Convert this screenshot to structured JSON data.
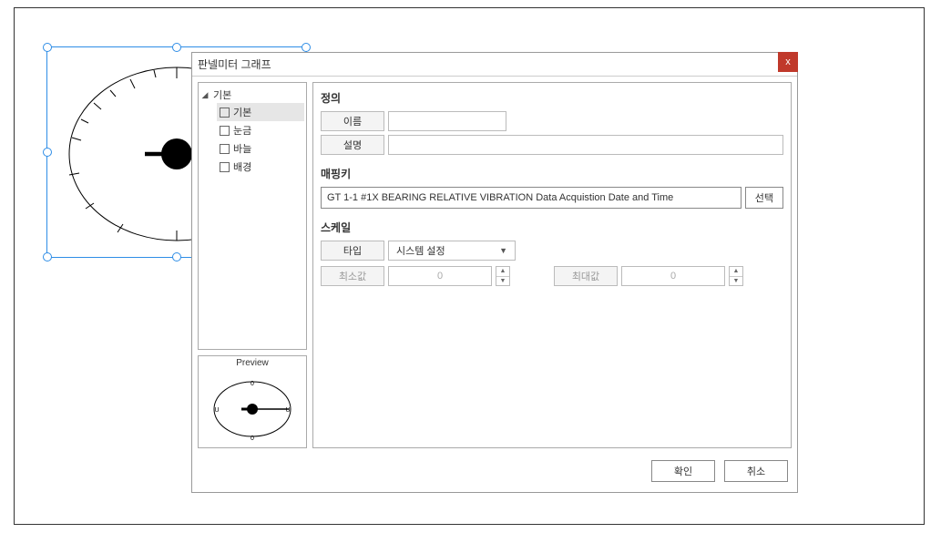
{
  "dialog": {
    "title": "판넬미터 그래프",
    "close": "x"
  },
  "tree": {
    "root": "기본",
    "items": [
      "기본",
      "눈금",
      "바늘",
      "배경"
    ],
    "selected_index": 0
  },
  "preview": {
    "title": "Preview"
  },
  "sections": {
    "definition": "정의",
    "mapping": "매핑키",
    "scale": "스케일"
  },
  "definition": {
    "name_label": "이름",
    "name_value": "",
    "desc_label": "설명",
    "desc_value": ""
  },
  "mapping": {
    "value": "GT 1-1 #1X BEARING RELATIVE VIBRATION Data Acquistion Date and Time",
    "select_button": "선택"
  },
  "scale": {
    "type_label": "타입",
    "type_value": "시스템 설정",
    "min_label": "최소값",
    "min_value": "0",
    "max_label": "최대값",
    "max_value": "0"
  },
  "footer": {
    "ok": "확인",
    "cancel": "취소"
  }
}
